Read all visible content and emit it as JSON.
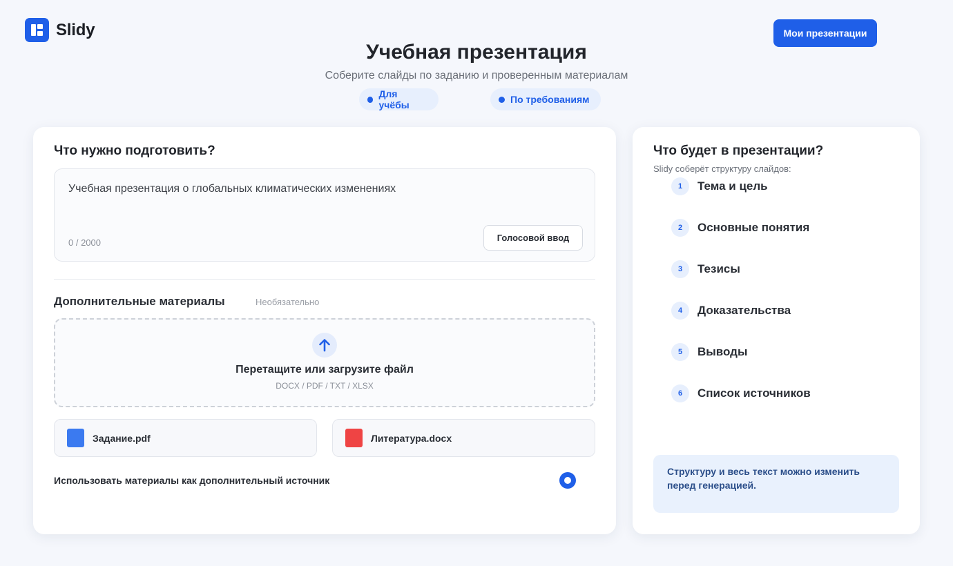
{
  "header": {
    "app_name": "Slidy",
    "my_presentations": "Мои презентации",
    "title": "Учебная презентация",
    "subtitle": "Соберите слайды по заданию и проверенным материалам",
    "chips": [
      "Для учёбы",
      "По требованиям"
    ]
  },
  "left": {
    "heading": "Что нужно подготовить?",
    "prompt_value": "Учебная презентация о глобальных климатических изменениях",
    "counter": "0 / 2000",
    "voice_button": "Голосовой ввод",
    "materials_title": "Дополнительные материалы",
    "optional": "Необязательно",
    "drop_text": "Перетащите или загрузите файл",
    "drop_formats": "DOCX / PDF / TXT / XLSX",
    "files": [
      {
        "name": "Задание.pdf",
        "color": "#3b7af0"
      },
      {
        "name": "Литература.docx",
        "color": "#ef4444"
      }
    ],
    "use_materials_label": "Использовать материалы как дополнительный источник"
  },
  "right": {
    "heading": "Что будет в презентации?",
    "subheading": "Slidy соберёт структуру слайдов:",
    "steps": [
      {
        "num": "1",
        "label": "Тема и цель"
      },
      {
        "num": "2",
        "label": "Основные понятия"
      },
      {
        "num": "3",
        "label": "Тезисы"
      },
      {
        "num": "4",
        "label": "Доказательства"
      },
      {
        "num": "5",
        "label": "Выводы"
      },
      {
        "num": "6",
        "label": "Список источников"
      }
    ],
    "note": "Структуру и весь текст можно изменить перед генерацией."
  },
  "colors": {
    "accent": "#1f5fe8",
    "chip_bg": "#e7effd",
    "note_bg": "#e9f1fd"
  }
}
